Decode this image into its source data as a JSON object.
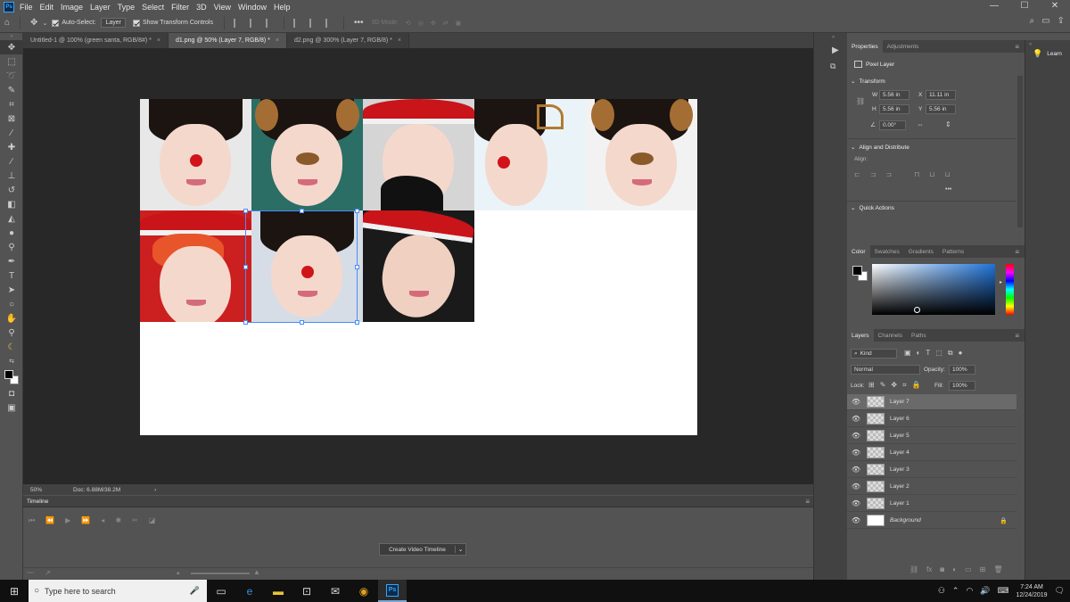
{
  "menubar": {
    "logo": "Ps",
    "items": [
      "File",
      "Edit",
      "Image",
      "Layer",
      "Type",
      "Select",
      "Filter",
      "3D",
      "View",
      "Window",
      "Help"
    ]
  },
  "window_controls": {
    "minimize": "—",
    "maximize": "☐",
    "close": "✕"
  },
  "options_bar": {
    "auto_select_label": "Auto-Select:",
    "auto_select_value": "Layer",
    "show_transform_label": "Show Transform Controls",
    "mode_3d_label": "3D Mode:",
    "more": "•••"
  },
  "doc_tabs": [
    {
      "label": "Untitled-1 @ 100% (green santa, RGB/8#) *",
      "close": "×"
    },
    {
      "label": "d1.png @ 50% (Layer 7, RGB/8) *",
      "close": "×"
    },
    {
      "label": "d2.png @ 300% (Layer 7, RGB/8) *",
      "close": "×"
    }
  ],
  "status": {
    "zoom": "50%",
    "doc": "Doc: 6.88M/38.2M",
    "arrow": "›"
  },
  "timeline": {
    "title": "Timeline",
    "create_button": "Create Video Timeline",
    "dropdown": "⌄"
  },
  "properties": {
    "tabs": [
      "Properties",
      "Adjustments"
    ],
    "layer_type": "Pixel Layer",
    "transform_title": "Transform",
    "w_label": "W",
    "w_value": "5.56 in",
    "x_label": "X",
    "x_value": "11.11 in",
    "h_label": "H",
    "h_value": "5.56 in",
    "y_label": "Y",
    "y_value": "5.56 in",
    "angle_value": "0.00°",
    "align_title": "Align and Distribute",
    "align_label": "Align:",
    "quick_actions_title": "Quick Actions",
    "more": "•••"
  },
  "color_panel": {
    "tabs": [
      "Color",
      "Swatches",
      "Gradients",
      "Patterns"
    ]
  },
  "layers_panel": {
    "tabs": [
      "Layers",
      "Channels",
      "Paths"
    ],
    "kind_label": "Kind",
    "blend_mode": "Normal",
    "opacity_label": "Opacity:",
    "opacity_value": "100%",
    "lock_label": "Lock:",
    "fill_label": "Fill:",
    "fill_value": "100%",
    "layers": [
      {
        "name": "Layer 7",
        "selected": true
      },
      {
        "name": "Layer 6",
        "selected": false
      },
      {
        "name": "Layer 5",
        "selected": false
      },
      {
        "name": "Layer 4",
        "selected": false
      },
      {
        "name": "Layer 3",
        "selected": false
      },
      {
        "name": "Layer 2",
        "selected": false
      },
      {
        "name": "Layer 1",
        "selected": false
      },
      {
        "name": "Background",
        "selected": false
      }
    ]
  },
  "learn": {
    "label": "Learn"
  },
  "taskbar": {
    "search_placeholder": "Type here to search",
    "time": "7:24 AM",
    "date": "12/24/2019"
  },
  "colors": {
    "accent": "#31a8ff",
    "selection": "#4b8df5",
    "bg_dark": "#282828",
    "panel": "#535353"
  }
}
